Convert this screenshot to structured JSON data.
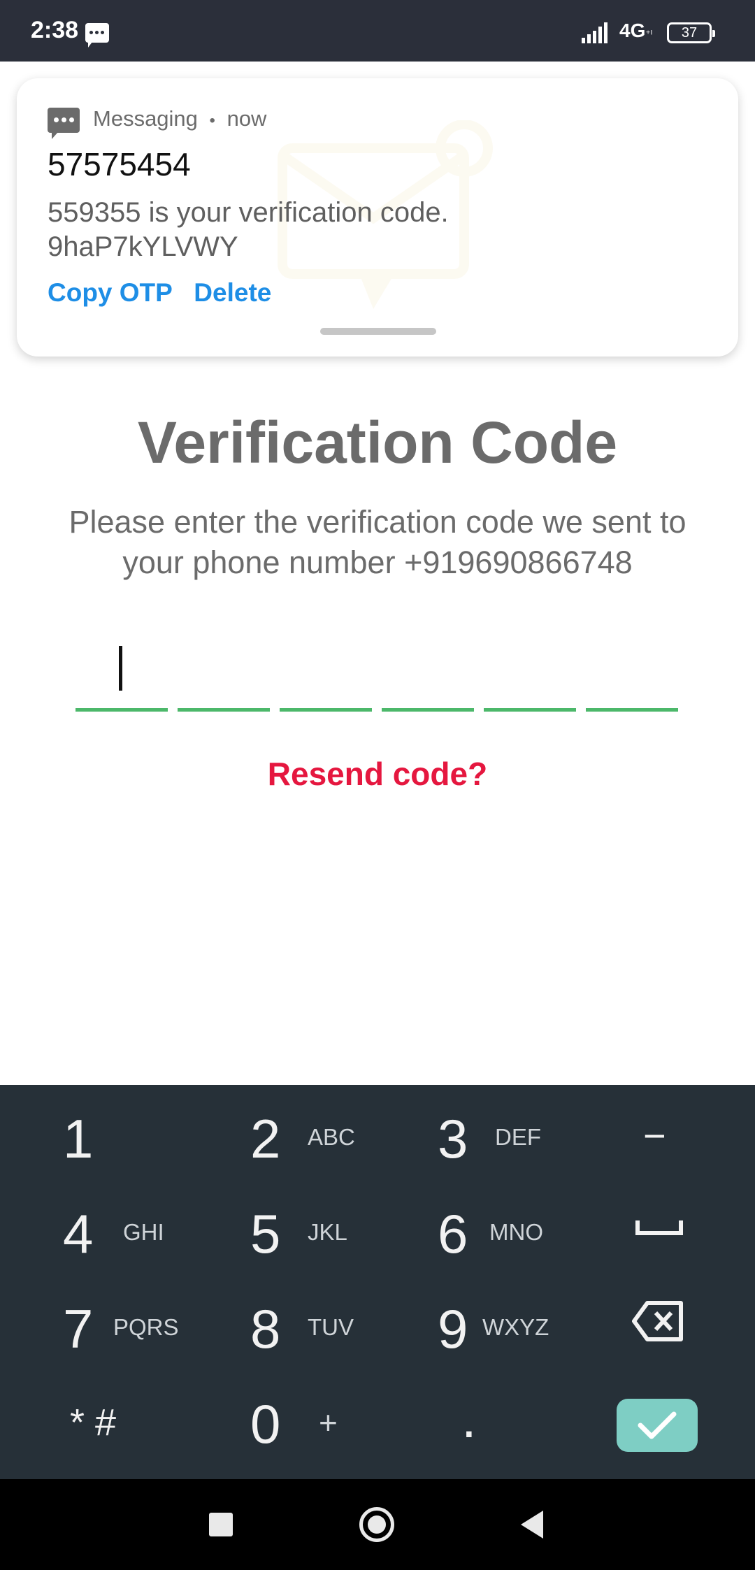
{
  "status_bar": {
    "time": "2:38",
    "network": "4G",
    "network_sub": "⁺ᴵ",
    "battery": "37",
    "icons": [
      "message-icon",
      "signal-icon",
      "battery-icon"
    ]
  },
  "notification": {
    "app_name": "Messaging",
    "separator": "•",
    "when": "now",
    "sender": "57575454",
    "body_line1": "559355 is your verification code.",
    "body_line2": "9haP7kYLVWY",
    "actions": [
      "Copy OTP",
      "Delete"
    ]
  },
  "screen": {
    "title": "Verification Code",
    "subtitle": "Please enter the verification code we sent to your phone number +919690866748",
    "otp_length": 6,
    "otp_values": [
      "",
      "",
      "",
      "",
      "",
      ""
    ],
    "resend_label": "Resend code?"
  },
  "keypad": {
    "keys": [
      {
        "digit": "1",
        "letters": ""
      },
      {
        "digit": "2",
        "letters": "ABC"
      },
      {
        "digit": "3",
        "letters": "DEF"
      },
      {
        "digit": "−",
        "letters": ""
      },
      {
        "digit": "4",
        "letters": "GHI"
      },
      {
        "digit": "5",
        "letters": "JKL"
      },
      {
        "digit": "6",
        "letters": "MNO"
      },
      {
        "digit": "␣",
        "letters": ""
      },
      {
        "digit": "7",
        "letters": "PQRS"
      },
      {
        "digit": "8",
        "letters": "TUV"
      },
      {
        "digit": "9",
        "letters": "WXYZ"
      },
      {
        "digit": "⌫",
        "letters": ""
      },
      {
        "digit": "* #",
        "letters": ""
      },
      {
        "digit": "0",
        "letters": "+"
      },
      {
        "digit": ".",
        "letters": ""
      }
    ],
    "confirm_icon": "check-icon"
  },
  "colors": {
    "status_bar_bg": "#2b2f3a",
    "accent_link": "#1e8ee6",
    "otp_underline": "#4cb86a",
    "resend": "#e5173f",
    "keypad_bg": "#263038",
    "confirm_bg": "#7ecec4"
  }
}
